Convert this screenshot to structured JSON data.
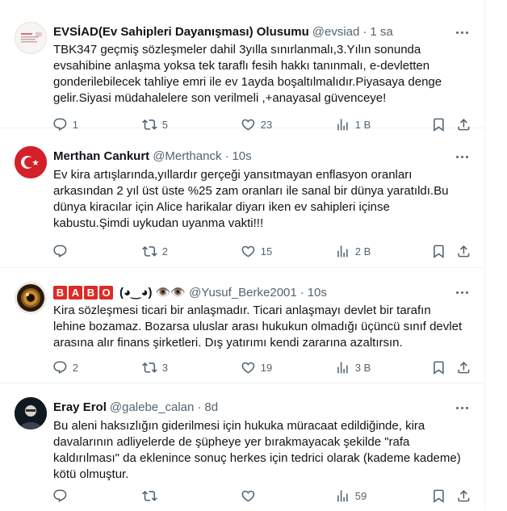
{
  "tweets": [
    {
      "name": "EVSİAD(Ev Sahipleri Dayanışması) Olusumu",
      "handle": "@evsiad",
      "time": "1 sa",
      "lines": [
        "TBK347 geçmiş sözleşmeler dahil 3yılla sınırlanmalı,3.Yılın sonunda",
        "evsahibine anlaşma yoksa tek taraflı fesih hakkı tanınmalı, e-devletten",
        "gonderilebilecek tahliye emri ile ev 1ayda boşaltılmalıdır.Piyasaya denge",
        "gelir.Siyasi müdahalelere son verilmeli ,+anayasal güvenceye!"
      ],
      "replies": "1",
      "reposts": "5",
      "likes": "23",
      "views": "1 B"
    },
    {
      "name": "Merthan Cankurt",
      "handle": "@Merthanck",
      "time": "10s",
      "lines": [
        "Ev kira artışlarında,yıllardır gerçeği yansıtmayan enflasyon oranları",
        "arkasından 2 yıl üst üste %25 zam oranları ile sanal bir dünya yaratıldı.Bu",
        "dünya kiracılar için Alice harikalar diyarı iken ev sahipleri içinse",
        "kabustu.Şimdi uykudan uyanma vakti!!!"
      ],
      "replies": "",
      "reposts": "2",
      "likes": "15",
      "views": "2 B"
    },
    {
      "name_badge": [
        "B",
        "A",
        "B",
        "O"
      ],
      "name_rest": "(◕‿◕) 👁️👁️",
      "handle": "@Yusuf_Berke2001",
      "time": "10s",
      "lines": [
        "Kira sözleşmesi ticari bir anlaşmadır. Ticari anlaşmayı devlet bir tarafın",
        "lehine bozamaz. Bozarsa uluslar arası hukukun olmadığı üçüncü sınıf devlet",
        "arasına alır finans şirketleri. Dış yatırımı kendi zararına azaltırsın."
      ],
      "replies": "2",
      "reposts": "3",
      "likes": "19",
      "views": "3 B"
    },
    {
      "name": "Eray Erol",
      "handle": "@galebe_calan",
      "time": "8d",
      "lines": [
        "Bu aleni haksızlığın giderilmesi için hukuka müracaat edildiğinde, kira",
        "davalarının adliyelerde de şüpheye yer bırakmayacak şekilde \"rafa",
        "kaldırılması\" da eklenince sonuç herkes için tedrici olarak (kademe kademe)",
        "kötü olmuştur."
      ],
      "replies": "",
      "reposts": "",
      "likes": "",
      "views": "59"
    }
  ],
  "separator": "·",
  "icons": {
    "reply": "reply-icon",
    "repost": "repost-icon",
    "like": "heart-icon",
    "views": "views-icon",
    "bookmark": "bookmark-icon",
    "share": "share-icon",
    "more": "more-icon"
  },
  "colors": {
    "text": "#0f1419",
    "muted": "#536471",
    "border": "#eff3f4",
    "badge": "#e02a24"
  }
}
